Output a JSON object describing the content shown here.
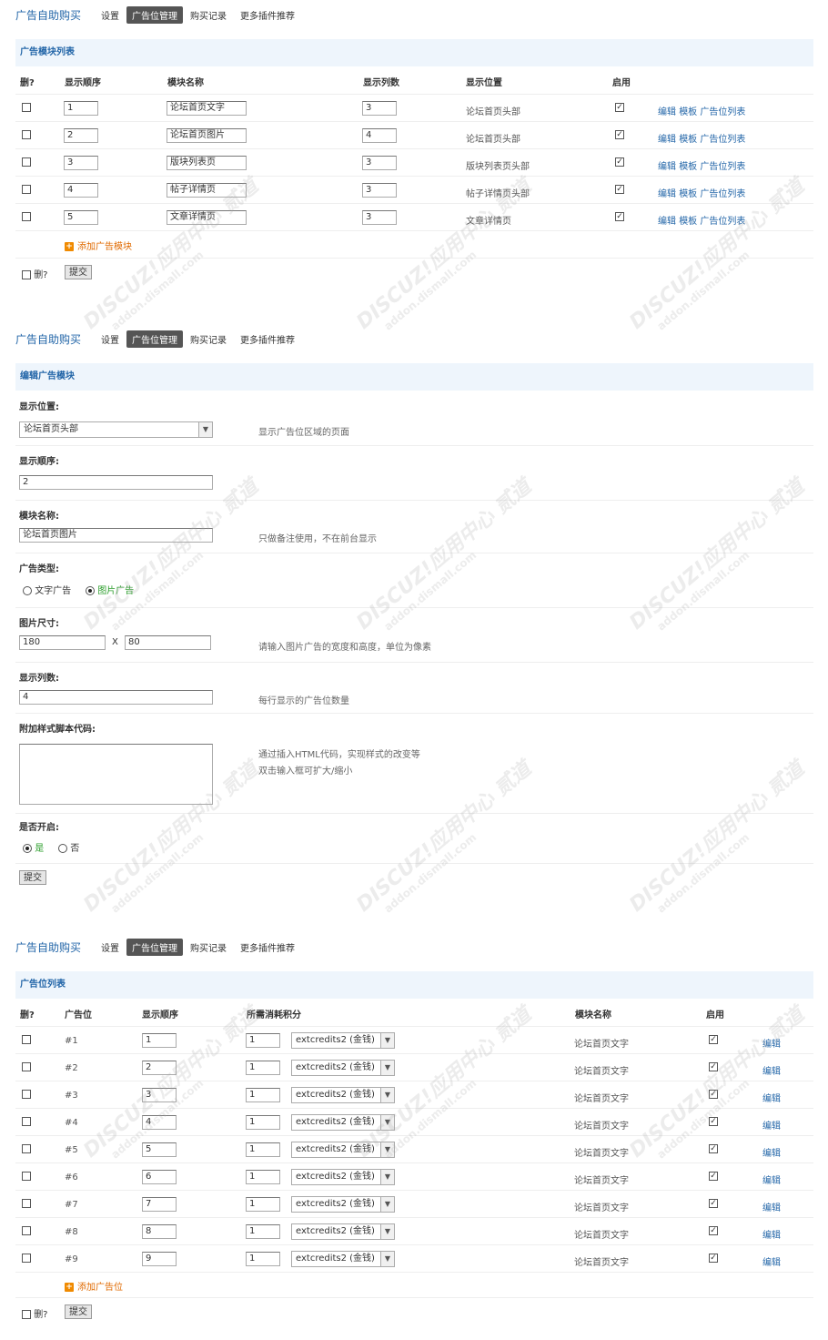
{
  "nav": {
    "brand": "广告自助购买",
    "items": [
      "设置",
      "广告位管理",
      "购买记录",
      "更多插件推荐"
    ],
    "active_index": 1
  },
  "module_list": {
    "title": "广告模块列表",
    "headers": [
      "删?",
      "显示顺序",
      "模块名称",
      "显示列数",
      "显示位置",
      "启用"
    ],
    "rows": [
      {
        "order": "1",
        "name": "论坛首页文字",
        "cols": "3",
        "position": "论坛首页头部",
        "enabled": true
      },
      {
        "order": "2",
        "name": "论坛首页图片",
        "cols": "4",
        "position": "论坛首页头部",
        "enabled": true
      },
      {
        "order": "3",
        "name": "版块列表页",
        "cols": "3",
        "position": "版块列表页头部",
        "enabled": true
      },
      {
        "order": "4",
        "name": "帖子详情页",
        "cols": "3",
        "position": "帖子详情页头部",
        "enabled": true
      },
      {
        "order": "5",
        "name": "文章详情页",
        "cols": "3",
        "position": "文章详情页",
        "enabled": true
      }
    ],
    "actions": [
      "编辑",
      "模板",
      "广告位列表"
    ],
    "add_label": "添加广告模块",
    "delete_label": "删?",
    "submit_label": "提交"
  },
  "edit_module": {
    "title": "编辑广告模块",
    "position_label": "显示位置:",
    "position_value": "论坛首页头部",
    "position_hint": "显示广告位区域的页面",
    "order_label": "显示顺序:",
    "order_value": "2",
    "name_label": "模块名称:",
    "name_value": "论坛首页图片",
    "name_hint": "只做备注使用，不在前台显示",
    "type_label": "广告类型:",
    "type_text": "文字广告",
    "type_image": "图片广告",
    "size_label": "图片尺寸:",
    "width_value": "180",
    "size_sep": "X",
    "height_value": "80",
    "size_hint": "请输入图片广告的宽度和高度，单位为像素",
    "cols_label": "显示列数:",
    "cols_value": "4",
    "cols_hint": "每行显示的广告位数量",
    "style_label": "附加样式脚本代码:",
    "style_hint1": "通过插入HTML代码，实现样式的改变等",
    "style_hint2": "双击输入框可扩大/缩小",
    "open_label": "是否开启:",
    "open_yes": "是",
    "open_no": "否",
    "submit_label": "提交"
  },
  "slot_list": {
    "title": "广告位列表",
    "headers": [
      "删?",
      "广告位",
      "显示顺序",
      "所需消耗积分",
      "模块名称",
      "启用"
    ],
    "rows": [
      {
        "id": "#1",
        "order": "1",
        "cost": "1",
        "credit": "extcredits2 (金钱)",
        "module": "论坛首页文字",
        "enabled": true
      },
      {
        "id": "#2",
        "order": "2",
        "cost": "1",
        "credit": "extcredits2 (金钱)",
        "module": "论坛首页文字",
        "enabled": true
      },
      {
        "id": "#3",
        "order": "3",
        "cost": "1",
        "credit": "extcredits2 (金钱)",
        "module": "论坛首页文字",
        "enabled": true
      },
      {
        "id": "#4",
        "order": "4",
        "cost": "1",
        "credit": "extcredits2 (金钱)",
        "module": "论坛首页文字",
        "enabled": true
      },
      {
        "id": "#5",
        "order": "5",
        "cost": "1",
        "credit": "extcredits2 (金钱)",
        "module": "论坛首页文字",
        "enabled": true
      },
      {
        "id": "#6",
        "order": "6",
        "cost": "1",
        "credit": "extcredits2 (金钱)",
        "module": "论坛首页文字",
        "enabled": true
      },
      {
        "id": "#7",
        "order": "7",
        "cost": "1",
        "credit": "extcredits2 (金钱)",
        "module": "论坛首页文字",
        "enabled": true
      },
      {
        "id": "#8",
        "order": "8",
        "cost": "1",
        "credit": "extcredits2 (金钱)",
        "module": "论坛首页文字",
        "enabled": true
      },
      {
        "id": "#9",
        "order": "9",
        "cost": "1",
        "credit": "extcredits2 (金钱)",
        "module": "论坛首页文字",
        "enabled": true
      }
    ],
    "edit_label": "编辑",
    "add_label": "添加广告位",
    "delete_label": "删?",
    "submit_label": "提交"
  },
  "watermark": {
    "brand": "DISCUZ!应用中心",
    "site": "addon.dismall.com",
    "extra": "贰道"
  },
  "colors": {
    "accent": "#2366a8",
    "panel_bg": "#eef5fc",
    "orange": "#e06a00",
    "green": "#2a9d2a"
  }
}
